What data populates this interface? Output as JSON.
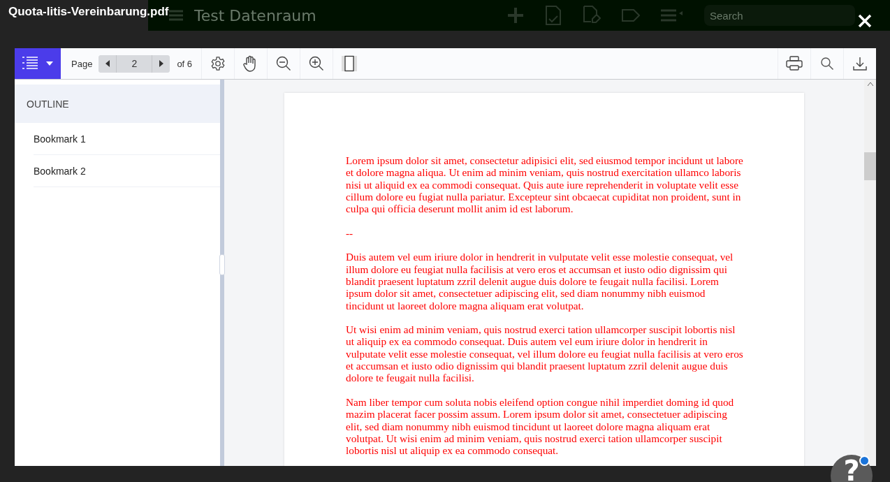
{
  "background_app": {
    "title": "Test Datenraum",
    "search": {
      "placeholder": "Search"
    }
  },
  "dialog": {
    "title": "Quota-litis-Vereinbarung.pdf"
  },
  "toolbar": {
    "sidebar_toggle": {
      "selected": true
    },
    "page_label": "Page",
    "page_value": "2",
    "page_total": "of 6"
  },
  "sidebar": {
    "heading": "OUTLINE",
    "bookmarks": [
      {
        "label": "Bookmark 1"
      },
      {
        "label": "Bookmark 2"
      }
    ]
  },
  "document": {
    "paragraphs": [
      "Lorem ipsum dolor sit amet, consectetur adipisici elit, sed eiusmod tempor incidunt ut labore et dolore magna aliqua. Ut enim ad minim veniam, quis nostrud exercitation ullamco laboris nisi ut aliquid ex ea commodi consequat. Quis aute iure reprehenderit in voluptate velit esse cillum dolore eu fugiat nulla pariatur. Excepteur sint obcaecat cupiditat non proident, sunt in culpa qui officia deserunt mollit anim id est laborum.",
      "--",
      "Duis autem vel eum iriure dolor in hendrerit in vulputate velit esse molestie consequat, vel illum dolore eu feugiat nulla facilisis at vero eros et accumsan et iusto odio dignissim qui blandit praesent luptatum zzril delenit augue duis dolore te feugait nulla facilisi. Lorem ipsum dolor sit amet, consectetuer adipiscing elit, sed diam nonummy nibh euismod tincidunt ut laoreet dolore magna aliquam erat volutpat.",
      "Ut wisi enim ad minim veniam, quis nostrud exerci tation ullamcorper suscipit lobortis nisl ut aliquip ex ea commodo consequat. Duis autem vel eum iriure dolor in hendrerit in vulputate velit esse molestie consequat, vel illum dolore eu feugiat nulla facilisis at vero eros et accumsan et iusto odio dignissim qui blandit praesent luptatum zzril delenit augue duis dolore te feugait nulla facilisi.",
      "Nam liber tempor cum soluta nobis eleifend option congue nihil imperdiet doming id quod mazim placerat facer possim assum. Lorem ipsum dolor sit amet, consectetuer adipiscing elit, sed diam nonummy nibh euismod tincidunt ut laoreet dolore magna aliquam erat volutpat. Ut wisi enim ad minim veniam, quis nostrud exerci tation ullamcorper suscipit lobortis nisl ut aliquip ex ea commodo consequat."
    ]
  },
  "help_button": {
    "label": "?",
    "notification": true
  }
}
